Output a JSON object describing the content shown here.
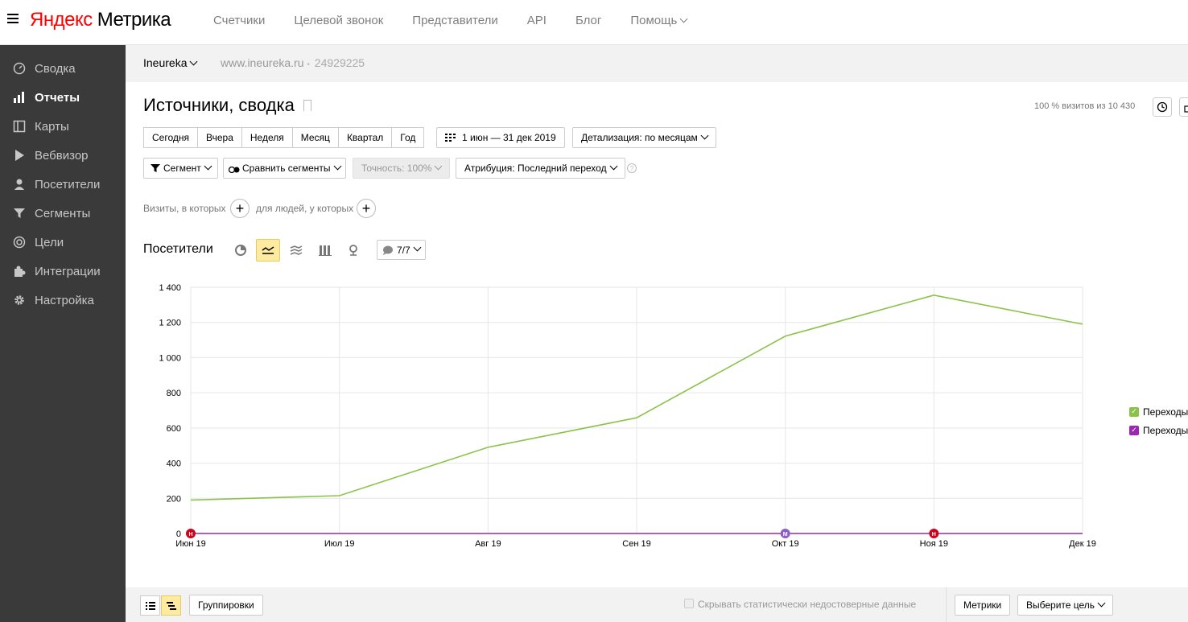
{
  "app": {
    "logo_yandex": "Яндекс",
    "logo_metrika": "Метрика"
  },
  "topnav": {
    "items": [
      "Счетчики",
      "Целевой звонок",
      "Представители",
      "API",
      "Блог",
      "Помощь"
    ]
  },
  "sidebar": {
    "items": [
      {
        "label": "Сводка",
        "icon": "dashboard-icon"
      },
      {
        "label": "Отчеты",
        "icon": "bar-chart-icon",
        "active": true
      },
      {
        "label": "Карты",
        "icon": "map-icon"
      },
      {
        "label": "Вебвизор",
        "icon": "play-icon"
      },
      {
        "label": "Посетители",
        "icon": "user-icon"
      },
      {
        "label": "Сегменты",
        "icon": "filter-icon"
      },
      {
        "label": "Цели",
        "icon": "target-icon"
      },
      {
        "label": "Интеграции",
        "icon": "puzzle-icon"
      },
      {
        "label": "Настройка",
        "icon": "gear-icon"
      }
    ]
  },
  "counter": {
    "name": "Ineureka",
    "site": "www.ineureka.ru",
    "separator": "•",
    "id": "24929225"
  },
  "report": {
    "title": "Источники, сводка",
    "visits_info": "100 % визитов из 10 430"
  },
  "periods": [
    "Сегодня",
    "Вчера",
    "Неделя",
    "Месяц",
    "Квартал",
    "Год"
  ],
  "date_range": "1 июн — 31 дек 2019",
  "detail": "Детализация: по месяцам",
  "segment_btn": "Сегмент",
  "compare_btn": "Сравнить сегменты",
  "accuracy_btn": "Точность: 100%",
  "attribution_btn": "Атрибуция: Последний переход",
  "help_mark": "?",
  "conditions": {
    "visits": "Визиты, в которых",
    "people": "для людей, у которых"
  },
  "chart_section": {
    "title": "Посетители",
    "series_count": "7/7"
  },
  "chart_data": {
    "type": "line",
    "categories": [
      "Июн 19",
      "Июл 19",
      "Авг 19",
      "Сен 19",
      "Окт 19",
      "Ноя 19",
      "Дек 19"
    ],
    "ylim": [
      0,
      1400
    ],
    "yticks": [
      "0",
      "200",
      "400",
      "600",
      "800",
      "1 000",
      "1 200",
      "1 400"
    ],
    "grid": true,
    "series": [
      {
        "name": "Переходы",
        "color": "#8bc34a",
        "values": [
          190,
          215,
          490,
          658,
          1122,
          1355,
          1190
        ]
      },
      {
        "name": "Переходы",
        "color": "#9c27b0",
        "values": [
          0,
          0,
          0,
          0,
          0,
          0,
          0
        ]
      }
    ],
    "markers": [
      {
        "category": "Июн 19",
        "color": "#d0021b",
        "letter": "Н"
      },
      {
        "category": "Окт 19",
        "color": "#8a5fc7",
        "letter": "М"
      },
      {
        "category": "Ноя 19",
        "color": "#d0021b",
        "letter": "Н"
      }
    ],
    "legend_position": "right"
  },
  "bottom": {
    "groupings": "Группировки",
    "hide_unreliable": "Скрывать статистически недостоверные данные",
    "metrics": "Метрики",
    "choose_goal": "Выберите цель"
  }
}
